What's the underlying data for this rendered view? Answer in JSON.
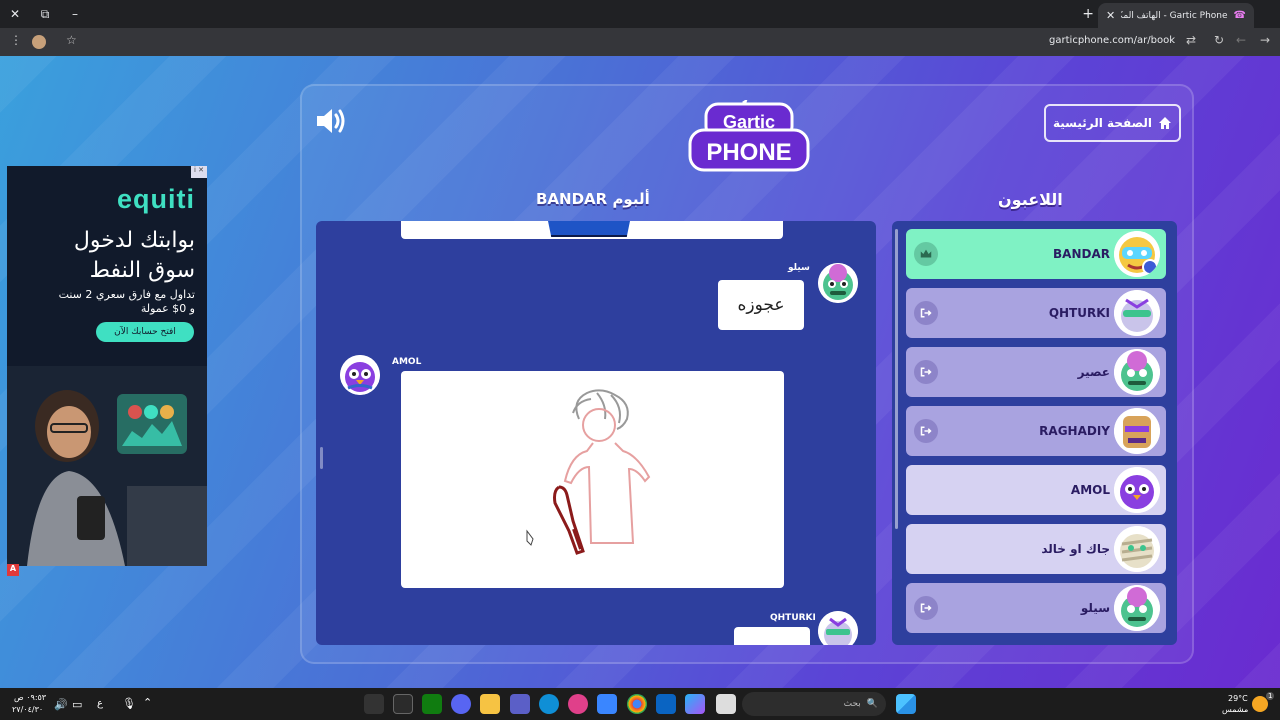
{
  "browser": {
    "tab_title": "Gartic Phone - الهاتف المكسور",
    "tab_favicon": "☎",
    "new_tab": "+",
    "url": "garticphone.com/ar/book",
    "window": {
      "close": "✕",
      "maximize": "⧉",
      "minimize": "–"
    }
  },
  "ad": {
    "logo": "equiti",
    "headline_line1": "بوابتك لدخول",
    "headline_line2": "سوق النفط",
    "sub_line1": "تداول مع فارق سعري 2 سنت",
    "sub_line2": "و 0$ عمولة",
    "cta": "افتح حسابك الآن",
    "badge": "i ✕",
    "flag": "A"
  },
  "game": {
    "home_label": "الصفحة الرئيسية",
    "logo_top": "Gartic",
    "logo_bottom": "PHONE",
    "album_title": "ألبوم BANDAR",
    "players_title": "اللاعبون",
    "album": [
      {
        "author": "سيلو",
        "text": "عجوزه"
      },
      {
        "author": "AMOL",
        "drawing": "old-woman-with-cane"
      },
      {
        "author": "QHTURKI"
      }
    ],
    "players": [
      {
        "name": "BANDAR",
        "status": "host",
        "icon": "crown-icon",
        "avatar_color": "#5bd6ff"
      },
      {
        "name": "QHTURKI",
        "status": "done",
        "icon": "exit-icon",
        "avatar_color": "#c9c4ea"
      },
      {
        "name": "عصير",
        "status": "done",
        "icon": "exit-icon",
        "avatar_color": "#4dc38f"
      },
      {
        "name": "RAGHADIY",
        "status": "done",
        "icon": "exit-icon",
        "avatar_color": "#d8a35a"
      },
      {
        "name": "AMOL",
        "status": "active",
        "icon": "",
        "avatar_color": "#8a3fe0"
      },
      {
        "name": "جاك او خالد",
        "status": "active",
        "icon": "",
        "avatar_color": "#e7e0c8"
      },
      {
        "name": "سيلو",
        "status": "done",
        "icon": "exit-icon",
        "avatar_color": "#4dc38f"
      }
    ]
  },
  "taskbar": {
    "time": "٠٩:٥٣ ص",
    "date": "٢٧/٠٤/٣٠",
    "lang": "ع",
    "search_placeholder": "بحث",
    "weather_temp": "29°C",
    "weather_text": "مشمس",
    "notif_count": "1"
  }
}
